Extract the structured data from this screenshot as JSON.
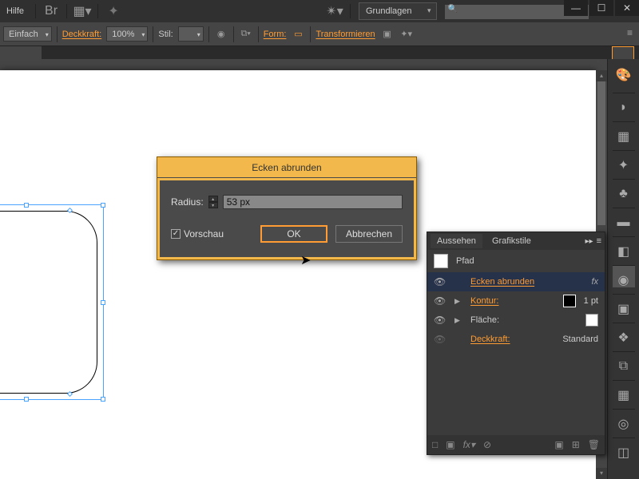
{
  "title_bar": {
    "help_label": "Hilfe",
    "workspace_label": "Grundlagen",
    "search_placeholder": ""
  },
  "control_bar": {
    "stroke_profile": "Einfach",
    "opacity_label": "Deckkraft:",
    "opacity_value": "100%",
    "style_label": "Stil:",
    "shape_label": "Form:",
    "transform_label": "Transformieren"
  },
  "dialog": {
    "title": "Ecken abrunden",
    "radius_label": "Radius:",
    "radius_value": "53 px",
    "preview_label": "Vorschau",
    "ok": "OK",
    "cancel": "Abbrechen"
  },
  "panel": {
    "tab_appearance": "Aussehen",
    "tab_styles": "Grafikstile",
    "object_type": "Pfad",
    "effect_row": "Ecken abrunden",
    "stroke_label": "Kontur:",
    "stroke_value": "1 pt",
    "fill_label": "Fläche:",
    "opacity_label": "Deckkraft:",
    "opacity_value": "Standard"
  }
}
